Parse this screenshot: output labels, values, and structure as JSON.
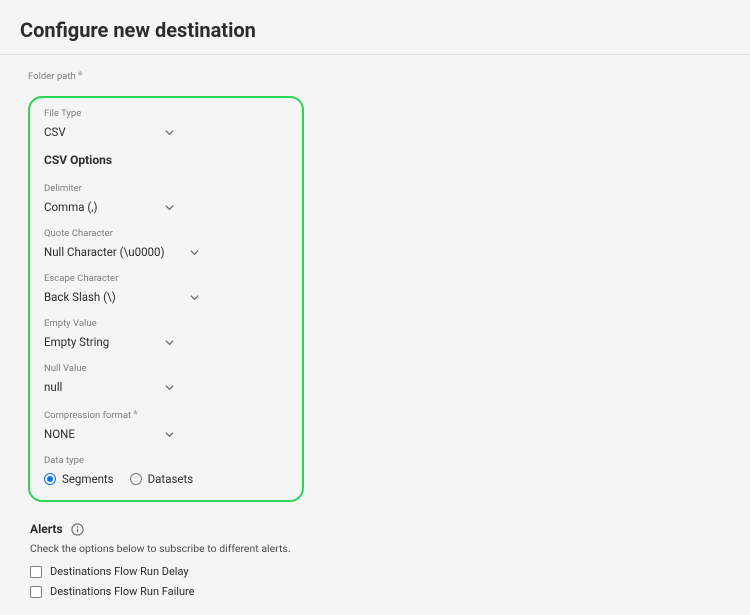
{
  "header": {
    "title": "Configure new destination"
  },
  "folderPath": {
    "label": "Folder path"
  },
  "fileType": {
    "label": "File Type",
    "value": "CSV"
  },
  "csvOptions": {
    "title": "CSV Options",
    "delimiter": {
      "label": "Delimiter",
      "value": "Comma (,)"
    },
    "quoteCharacter": {
      "label": "Quote Character",
      "value": "Null Character (\\u0000)"
    },
    "escapeCharacter": {
      "label": "Escape Character",
      "value": "Back Slash (\\)"
    },
    "emptyValue": {
      "label": "Empty Value",
      "value": "Empty String"
    },
    "nullValue": {
      "label": "Null Value",
      "value": "null"
    },
    "compressionFormat": {
      "label": "Compression format",
      "value": "NONE"
    }
  },
  "dataType": {
    "label": "Data type",
    "options": [
      {
        "label": "Segments",
        "selected": true
      },
      {
        "label": "Datasets",
        "selected": false
      }
    ]
  },
  "alerts": {
    "title": "Alerts",
    "description": "Check the options below to subscribe to different alerts.",
    "items": [
      {
        "label": "Destinations Flow Run Delay",
        "checked": false
      },
      {
        "label": "Destinations Flow Run Failure",
        "checked": false
      }
    ]
  }
}
